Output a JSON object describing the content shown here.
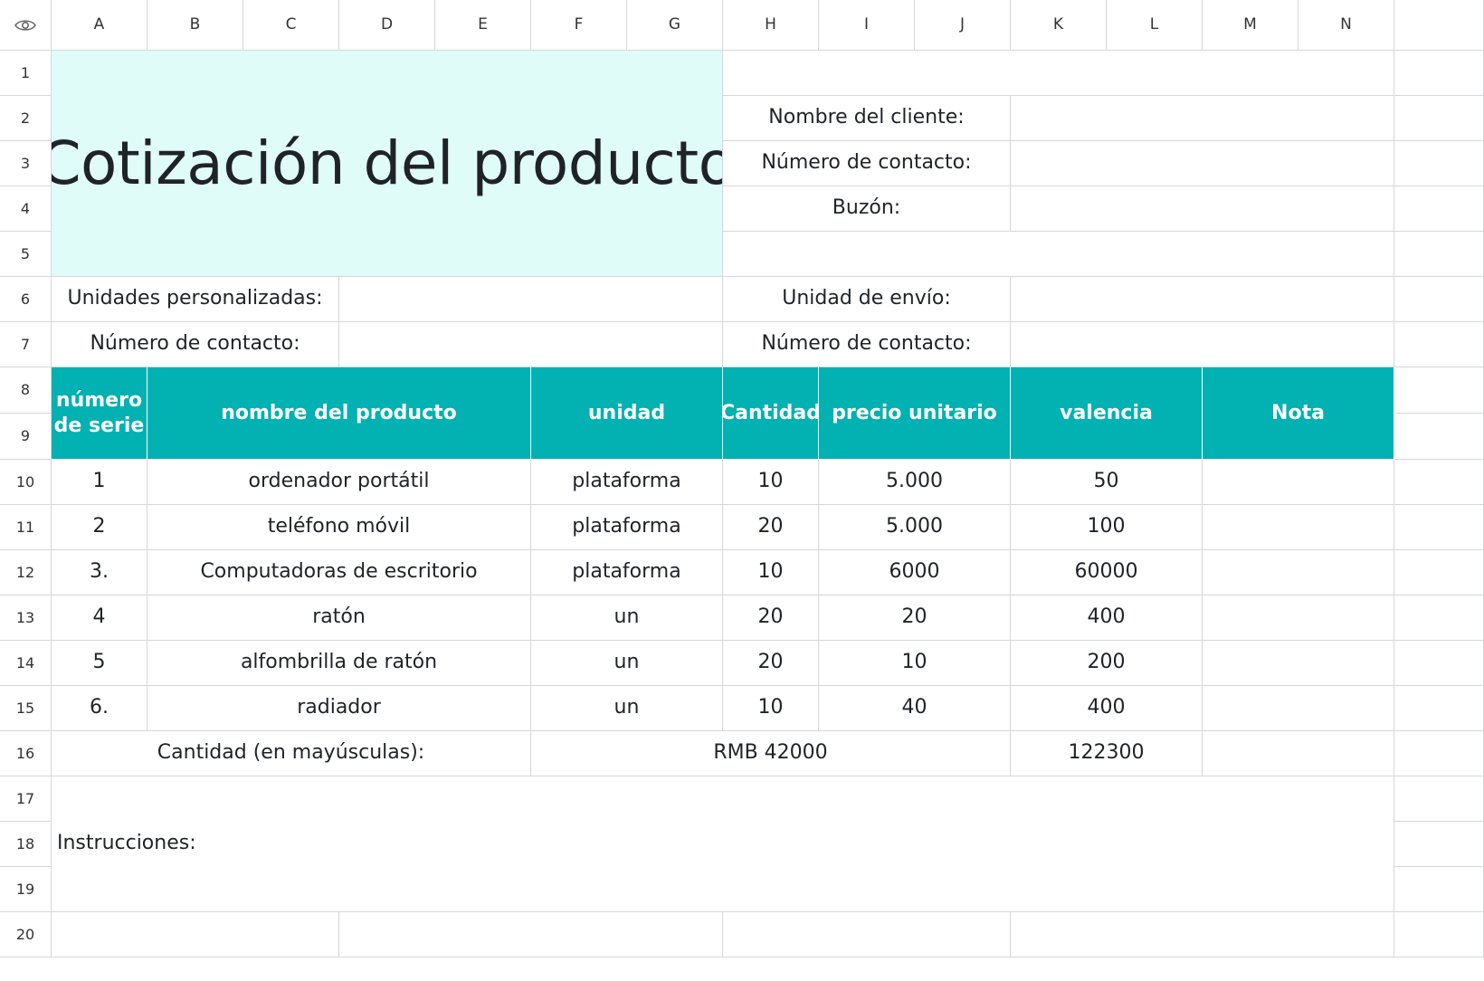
{
  "columns": [
    "A",
    "B",
    "C",
    "D",
    "E",
    "F",
    "G",
    "H",
    "I",
    "J",
    "K",
    "L",
    "M",
    "N"
  ],
  "rows": [
    "1",
    "2",
    "3",
    "4",
    "5",
    "6",
    "7",
    "8",
    "9",
    "10",
    "11",
    "12",
    "13",
    "14",
    "15",
    "16",
    "17",
    "18",
    "19",
    "20"
  ],
  "corner_icon": "eye-icon",
  "title": "Cotización del producto",
  "client": {
    "name_label": "Nombre del cliente:",
    "contact_label": "Número de contacto:",
    "mailbox_label": "Buzón:"
  },
  "custom_units_label": "Unidades personalizadas:",
  "contact_label_left": "Número de contacto:",
  "shipping_unit_label": "Unidad de envío:",
  "contact_label_right": "Número de contacto:",
  "table": {
    "headers": {
      "serial": "número de serie",
      "product": "nombre del producto",
      "unit": "unidad",
      "quantity": "Cantidad",
      "unit_price": "precio unitario",
      "value": "valencia",
      "note": "Nota"
    },
    "rows": [
      {
        "serial": "1",
        "product": "ordenador portátil",
        "unit": "plataforma",
        "quantity": "10",
        "unit_price": "5.000",
        "value": "50",
        "note": ""
      },
      {
        "serial": "2",
        "product": "teléfono móvil",
        "unit": "plataforma",
        "quantity": "20",
        "unit_price": "5.000",
        "value": "100",
        "note": ""
      },
      {
        "serial": "3.",
        "product": "Computadoras de escritorio",
        "unit": "plataforma",
        "quantity": "10",
        "unit_price": "6000",
        "value": "60000",
        "note": ""
      },
      {
        "serial": "4",
        "product": "ratón",
        "unit": "un",
        "quantity": "20",
        "unit_price": "20",
        "value": "400",
        "note": ""
      },
      {
        "serial": "5",
        "product": "alfombrilla de ratón",
        "unit": "un",
        "quantity": "20",
        "unit_price": "10",
        "value": "200",
        "note": ""
      },
      {
        "serial": "6.",
        "product": "radiador",
        "unit": "un",
        "quantity": "10",
        "unit_price": "40",
        "value": "400",
        "note": ""
      }
    ],
    "total_label": "Cantidad (en mayúsculas):",
    "total_rmb": "RMB 42000",
    "total_value": "122300"
  },
  "instructions_label": "Instrucciones:",
  "colors": {
    "title_bg": "#e0fcf9",
    "header_bg": "#02b1b1",
    "grid": "#d4d7db"
  }
}
